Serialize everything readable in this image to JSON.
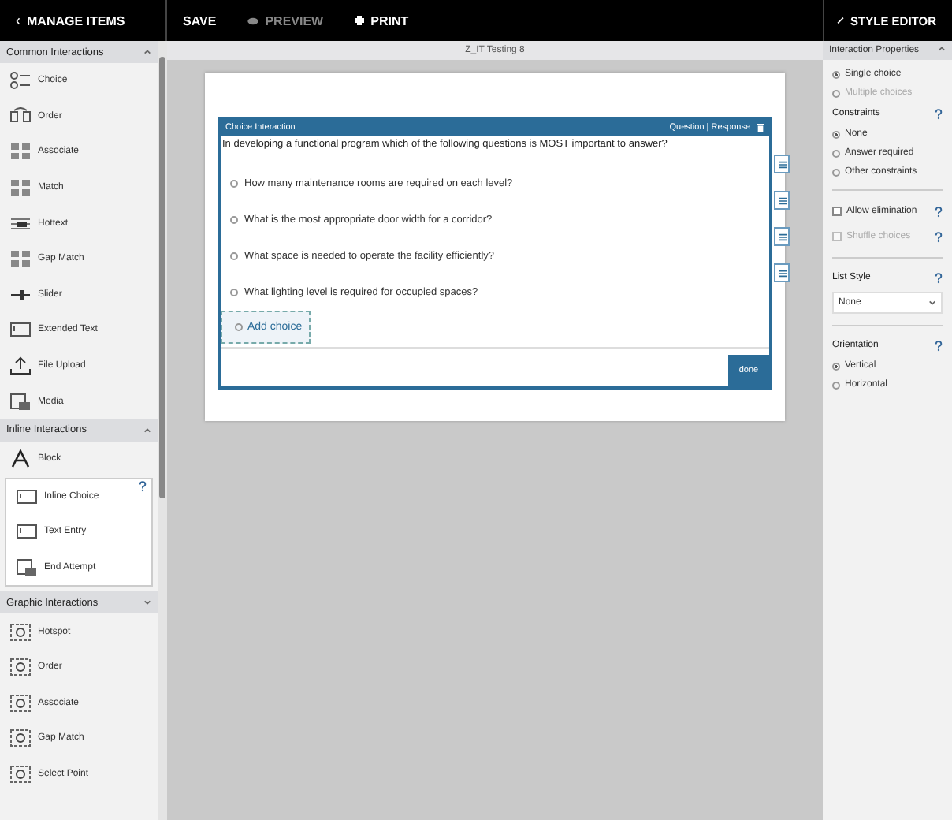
{
  "toolbar": {
    "manage_items": "MANAGE ITEMS",
    "save": "SAVE",
    "preview": "PREVIEW",
    "print": "PRINT",
    "style_editor": "STYLE EDITOR"
  },
  "sections": [
    {
      "title": "Common Interactions",
      "expanded": true,
      "items": [
        {
          "label": "Choice",
          "kind": "choice"
        },
        {
          "label": "Order",
          "kind": "order"
        },
        {
          "label": "Associate",
          "kind": "grid"
        },
        {
          "label": "Match",
          "kind": "grid"
        },
        {
          "label": "Hottext",
          "kind": "text"
        },
        {
          "label": "Gap Match",
          "kind": "grid"
        },
        {
          "label": "Slider",
          "kind": "slider"
        },
        {
          "label": "Extended Text",
          "kind": "box"
        },
        {
          "label": "File Upload",
          "kind": "upload"
        },
        {
          "label": "Media",
          "kind": "media"
        }
      ]
    },
    {
      "title": "Inline Interactions",
      "expanded": true,
      "items": [
        {
          "label": "Block",
          "kind": "block"
        }
      ],
      "subitems": [
        {
          "label": "Inline Choice",
          "kind": "box"
        },
        {
          "label": "Text Entry",
          "kind": "box"
        },
        {
          "label": "End Attempt",
          "kind": "media"
        }
      ]
    },
    {
      "title": "Graphic Interactions",
      "expanded": false,
      "items": [
        {
          "label": "Hotspot",
          "kind": "graphic"
        },
        {
          "label": "Order",
          "kind": "graphic"
        },
        {
          "label": "Associate",
          "kind": "graphic"
        },
        {
          "label": "Gap Match",
          "kind": "graphic"
        },
        {
          "label": "Select Point",
          "kind": "graphic"
        }
      ]
    }
  ],
  "document_title": "Z_IT Testing 8",
  "interaction": {
    "title": "Choice Interaction",
    "mode": "Question | Response",
    "prompt": "In developing a functional program which of the following questions is MOST important to answer?",
    "choices": [
      {
        "label": "How many maintenance rooms are required on each level?",
        "selected": false
      },
      {
        "label": "What is the most appropriate door width for a corridor?",
        "selected": false
      },
      {
        "label": "What space is needed to operate the facility efficiently?",
        "selected": false
      },
      {
        "label": "What lighting level is required for occupied spaces?",
        "selected": false
      }
    ],
    "add_choice": "Add choice",
    "done": "done"
  },
  "properties": {
    "title": "Interaction Properties",
    "choice_type": [
      {
        "label": "Single choice",
        "selected": true
      },
      {
        "label": "Multiple choices",
        "selected": false
      }
    ],
    "constraints_label": "Constraints",
    "constraints": [
      {
        "label": "None",
        "selected": true
      },
      {
        "label": "Answer required",
        "selected": false
      },
      {
        "label": "Other constraints",
        "selected": false
      }
    ],
    "options": [
      {
        "label": "Allow elimination",
        "checked": false,
        "disabled": false
      },
      {
        "label": "Shuffle choices",
        "checked": false,
        "disabled": true
      }
    ],
    "list_style_label": "List Style",
    "list_style": "None",
    "orientation_label": "Orientation",
    "orientation": [
      {
        "label": "Vertical",
        "selected": true
      },
      {
        "label": "Horizontal",
        "selected": false
      }
    ]
  }
}
